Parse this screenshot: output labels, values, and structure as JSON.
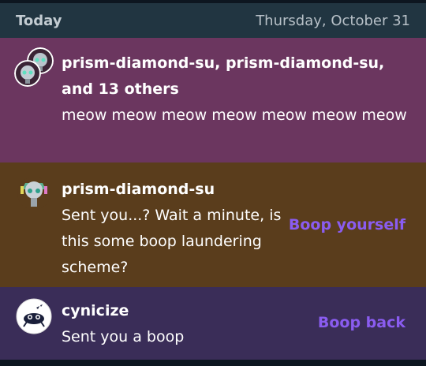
{
  "header": {
    "today_label": "Today",
    "date_label": "Thursday, October 31"
  },
  "notifications": [
    {
      "title": "prism-diamond-su, prism-diamond-su, and 13 others",
      "body": "meow meow meow meow meow meow meow",
      "action": ""
    },
    {
      "title": "prism-diamond-su",
      "body": "Sent you...? Wait a minute, is this some boop laundering scheme?",
      "action": "Boop yourself"
    },
    {
      "title": "cynicize",
      "body": "Sent you a boop",
      "action": "Boop back"
    }
  ],
  "colors": {
    "header_bg": "#213541",
    "notif1_bg": "#6b365f",
    "notif2_bg": "#5a3d1c",
    "notif3_bg": "#3a2d58",
    "action": "#8a5cf0"
  }
}
